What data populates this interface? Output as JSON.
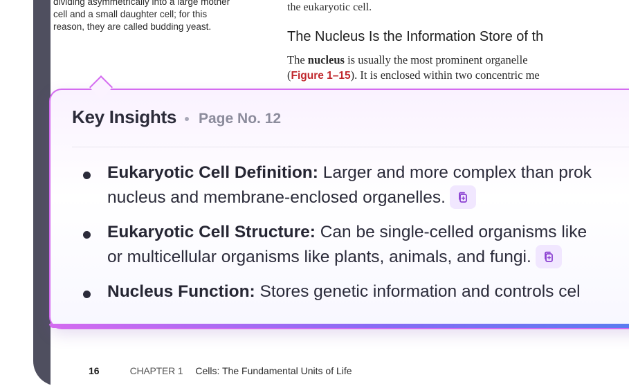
{
  "document": {
    "left_text": [
      "dividing asymmetrically into a large mother",
      "cell and a small daughter cell; for this",
      "reason, they are called budding yeast."
    ],
    "right_top_text": "the eukaryotic cell.",
    "section_heading": "The Nucleus Is the Information Store of th",
    "body_line1_pre": "The ",
    "body_line1_bold": "nucleus",
    "body_line1_post": " is usually the most prominent organelle",
    "body_line2_pre": "(",
    "body_line2_figref": "Figure 1–15",
    "body_line2_post": "). It is enclosed within two concentric me"
  },
  "footer": {
    "page_number": "16",
    "chapter": "CHAPTER 1",
    "chapter_title": "Cells: The Fundamental Units of Life"
  },
  "popup": {
    "title": "Key Insights",
    "page_label": "Page No. 12",
    "insights": [
      {
        "label": "Eukaryotic Cell Definition:",
        "line1": " Larger and more complex than prok",
        "line2": "nucleus and membrane-enclosed organelles.",
        "copy_icon": "copy-icon"
      },
      {
        "label": "Eukaryotic Cell Structure:",
        "line1": " Can be single-celled organisms like",
        "line2": "or multicellular organisms like plants, animals, and fungi.",
        "copy_icon": "copy-icon"
      },
      {
        "label": "Nucleus Function:",
        "line1": " Stores genetic information and controls cel"
      }
    ],
    "accent_color": "#d46bf0",
    "copy_icon_color": "#8a3fd1"
  }
}
